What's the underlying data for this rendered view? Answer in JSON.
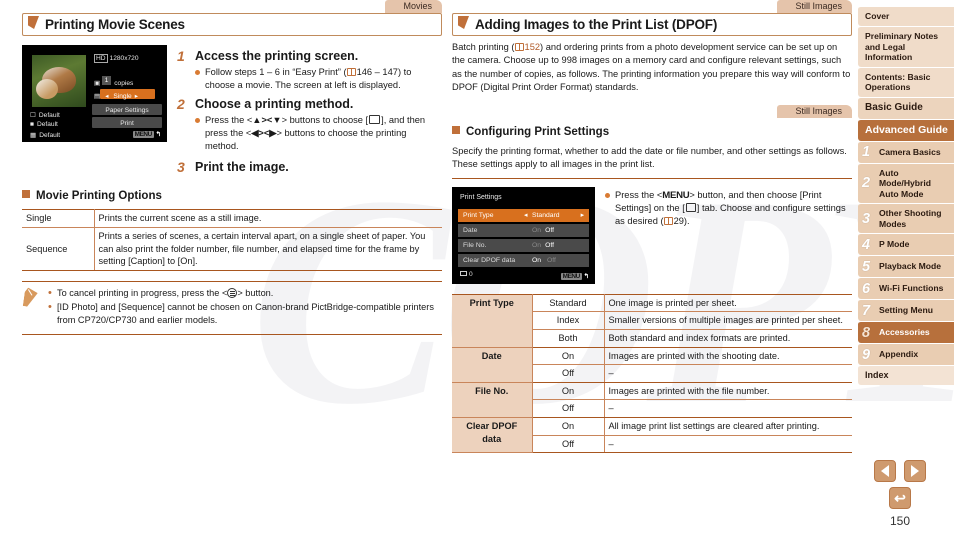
{
  "page_number": "150",
  "watermark": "COPY",
  "colors": {
    "accent_brown": "#c0703a",
    "rule_brown": "#a8561f",
    "tab_bg": "#e5c4ab",
    "sidebar_bg": "#f0dcc9",
    "sidebar_active": "#b7703c",
    "table_label_bg": "#edd2bd",
    "lcd_highlight": "#d8701e"
  },
  "left_column": {
    "tab_label": "Movies",
    "heading": "Printing Movie Scenes",
    "lcd": {
      "resolution": "1280x720",
      "copies_count": "1",
      "copies_label": "copies",
      "print_method": "Single",
      "default_1": "Default",
      "default_2": "Default",
      "default_3": "Default",
      "paper_settings": "Paper Settings",
      "print": "Print",
      "menu_badge": "MENU",
      "return_glyph": "↰"
    },
    "steps": [
      {
        "num": "1",
        "title": "Access the printing screen.",
        "bullets": [
          "Follow steps 1 – 6 in \"Easy Print\" ( 146 – 147) to choose a movie. The screen at left is displayed."
        ]
      },
      {
        "num": "2",
        "title": "Choose a printing method.",
        "bullets": [
          "Press the <▲><▼> buttons to choose [ ], and then press the <◀><▶> buttons to choose the printing method."
        ]
      },
      {
        "num": "3",
        "title": "Print the image.",
        "bullets": []
      }
    ],
    "step1_bullet_pre": "Follow steps 1 – 6 in “Easy Print” (",
    "step1_bullet_pages": "146 – 147",
    "step1_bullet_post": ") to choose a movie. The screen at left is displayed.",
    "step2_bullet_a": "Press the <",
    "step2_keys_updown": "▲><▼",
    "step2_bullet_b": "> buttons to choose [",
    "step2_bullet_c": "], and then press the <",
    "step2_keys_leftright": "◀><▶",
    "step2_bullet_d": "> buttons to choose the printing method.",
    "subheading": "Movie Printing Options",
    "options_table": {
      "rows": [
        {
          "name": "Single",
          "desc": "Prints the current scene as a still image."
        },
        {
          "name": "Sequence",
          "desc": "Prints a series of scenes, a certain interval apart, on a single sheet of paper. You can also print the folder number, file number, and elapsed time for the frame by setting [Caption] to [On]."
        }
      ]
    },
    "notes": {
      "note1_pre": "To cancel printing in progress, press the <",
      "note1_post": "> button.",
      "note2": "[ID Photo] and [Sequence] cannot be chosen on Canon-brand PictBridge-compatible printers from CP720/CP730 and earlier models."
    }
  },
  "right_column": {
    "tab_label_1": "Still Images",
    "heading_1": "Adding Images to the Print List (DPOF)",
    "intro_pre": "Batch printing (",
    "intro_page": "152",
    "intro_post": ") and ordering prints from a photo development service can be set up on the camera. Choose up to 998 images on a memory card and configure relevant settings, such as the number of copies, as follows. The printing information you prepare this way will conform to DPOF (Digital Print Order Format) standards.",
    "tab_label_2": "Still Images",
    "subheading": "Configuring Print Settings",
    "sub_intro": "Specify the printing format, whether to add the date or file number, and other settings as follows. These settings apply to all images in the print list.",
    "lcd": {
      "title": "Print Settings",
      "rows": [
        {
          "label": "Print Type",
          "dim": "",
          "value": "Standard",
          "selected": true
        },
        {
          "label": "Date",
          "dim": "On",
          "value": "Off",
          "selected": false
        },
        {
          "label": "File No.",
          "dim": "On",
          "value": "Off",
          "selected": false
        },
        {
          "label": "Clear DPOF data",
          "dim": "",
          "value": "On",
          "selected": false,
          "trailing_dim": "Off"
        }
      ],
      "count": "0",
      "menu_badge": "MENU",
      "return_glyph": "↰"
    },
    "bullet_pre": "Press the <",
    "bullet_menu": "MENU",
    "bullet_mid": "> button, and then choose [Print Settings] on the [",
    "bullet_mid2": "] tab. Choose and configure settings as desired (",
    "bullet_page": "29",
    "bullet_post": ").",
    "settings_table": {
      "groups": [
        {
          "label": "Print Type",
          "options": [
            {
              "option": "Standard",
              "desc": "One image is printed per sheet."
            },
            {
              "option": "Index",
              "desc": "Smaller versions of multiple images are printed per sheet."
            },
            {
              "option": "Both",
              "desc": "Both standard and index formats are printed."
            }
          ]
        },
        {
          "label": "Date",
          "options": [
            {
              "option": "On",
              "desc": "Images are printed with the shooting date."
            },
            {
              "option": "Off",
              "desc": "–"
            }
          ]
        },
        {
          "label": "File No.",
          "options": [
            {
              "option": "On",
              "desc": "Images are printed with the file number."
            },
            {
              "option": "Off",
              "desc": "–"
            }
          ]
        },
        {
          "label": "Clear DPOF data",
          "options": [
            {
              "option": "On",
              "desc": "All image print list settings are cleared after printing."
            },
            {
              "option": "Off",
              "desc": "–"
            }
          ]
        }
      ]
    }
  },
  "sidebar": {
    "items": [
      {
        "label": "Cover",
        "type": "plain",
        "num": ""
      },
      {
        "label": "Preliminary Notes and Legal Information",
        "type": "plain",
        "num": ""
      },
      {
        "label": "Contents: Basic Operations",
        "type": "plain",
        "num": ""
      },
      {
        "label": "Basic Guide",
        "type": "basic",
        "num": ""
      },
      {
        "label": "Advanced Guide",
        "type": "advanced",
        "num": ""
      },
      {
        "label": "Camera Basics",
        "type": "chap",
        "num": "1"
      },
      {
        "label": "Auto Mode/Hybrid Auto Mode",
        "type": "chap",
        "num": "2"
      },
      {
        "label": "Other Shooting Modes",
        "type": "chap",
        "num": "3"
      },
      {
        "label": "P Mode",
        "type": "chap",
        "num": "4"
      },
      {
        "label": "Playback Mode",
        "type": "chap",
        "num": "5"
      },
      {
        "label": "Wi-Fi Functions",
        "type": "chap",
        "num": "6"
      },
      {
        "label": "Setting Menu",
        "type": "chap",
        "num": "7"
      },
      {
        "label": "Accessories",
        "type": "chap",
        "num": "8",
        "active": true
      },
      {
        "label": "Appendix",
        "type": "chap",
        "num": "9"
      },
      {
        "label": "Index",
        "type": "index",
        "num": ""
      }
    ]
  },
  "page_nav": {
    "prev_icon": "prev-page-icon",
    "next_icon": "next-page-icon",
    "home_icon": "return-home-icon"
  }
}
